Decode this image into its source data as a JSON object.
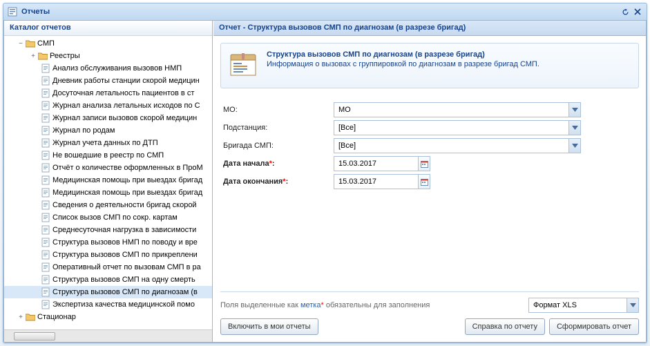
{
  "window": {
    "title": "Отчеты"
  },
  "catalog": {
    "header": "Каталог отчетов",
    "smp": "СМП",
    "registry": "Реестры",
    "items": [
      "Анализ обслуживания вызовов НМП",
      "Дневник работы станции скорой медицин",
      "Досуточная летальность пациентов в ст",
      "Журнал анализа летальных исходов по С",
      "Журнал записи вызовов скорой медицин",
      "Журнал по родам",
      "Журнал учета данных по ДТП",
      "Не вошедшие в реестр по СМП",
      "Отчёт о количестве оформленных в ПроМ",
      "Медицинская помощь при выездах бригад",
      "Медицинская помощь при выездах бригад",
      "Сведения о деятельности бригад скорой",
      "Список вызов СМП по сокр. картам",
      "Среднесуточная нагрузка в зависимости",
      "Структура вызовов НМП по поводу и вре",
      "Структура вызовов СМП по прикреплени",
      "Оперативный отчет по вызовам СМП в ра",
      "Структура вызовов СМП на одну смерть",
      "Структура вызовов СМП по диагнозам (в",
      "Экспертиза качества медицинской помо"
    ],
    "stacionar": "Стационар"
  },
  "report": {
    "header": "Отчет - Структура вызовов СМП по диагнозам (в разрезе бригад)",
    "title": "Структура вызовов СМП по диагнозам (в разрезе бригад)",
    "desc": "Информация о вызовах с группировкой по диагнозам в разрезе бригад СМП."
  },
  "form": {
    "mo_label": "МО:",
    "mo_value": "МО",
    "sub_label": "Подстанция:",
    "sub_value": "[Все]",
    "brig_label": "Бригада СМП:",
    "brig_value": "[Все]",
    "start_label": "Дата начала",
    "start_value": "15.03.2017",
    "end_label": "Дата окончания",
    "end_value": "15.03.2017"
  },
  "footer": {
    "note_pre": "Поля выделенные как ",
    "note_label": "метка",
    "note_post": " обязательны для заполнения",
    "format": "Формат XLS",
    "btn_add": "Включить в мои отчеты",
    "btn_help": "Справка по отчету",
    "btn_run": "Сформировать отчет"
  }
}
